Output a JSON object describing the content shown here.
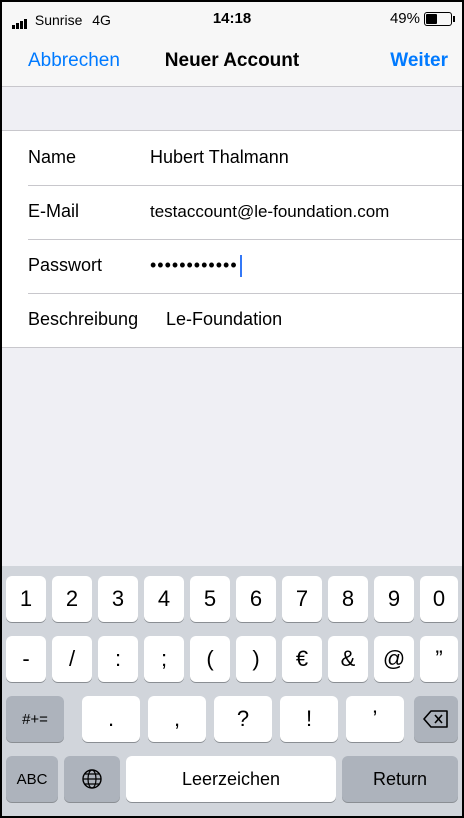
{
  "status_bar": {
    "carrier": "Sunrise",
    "network": "4G",
    "time": "14:18",
    "battery_percent": "49%",
    "battery_level": 0.49
  },
  "navbar": {
    "cancel_label": "Abbrechen",
    "title": "Neuer Account",
    "next_label": "Weiter"
  },
  "form": {
    "name": {
      "label": "Name",
      "value": "Hubert Thalmann"
    },
    "email": {
      "label": "E-Mail",
      "value": "testaccount@le-foundation.com"
    },
    "password": {
      "label": "Passwort",
      "value": "••••••••••••"
    },
    "description": {
      "label": "Beschreibung",
      "value": "Le-Foundation"
    }
  },
  "keyboard": {
    "row1": [
      "1",
      "2",
      "3",
      "4",
      "5",
      "6",
      "7",
      "8",
      "9",
      "0"
    ],
    "row2": [
      "-",
      "/",
      ":",
      ";",
      "(",
      ")",
      "€",
      "&",
      "@",
      "”"
    ],
    "row3": {
      "shift_label": "#+=",
      "keys": [
        ".",
        ",",
        "?",
        "!",
        "’"
      ],
      "backspace_icon": "backspace-icon"
    },
    "row4": {
      "abc_label": "ABC",
      "globe_icon": "globe-icon",
      "space_label": "Leerzeichen",
      "return_label": "Return"
    }
  }
}
